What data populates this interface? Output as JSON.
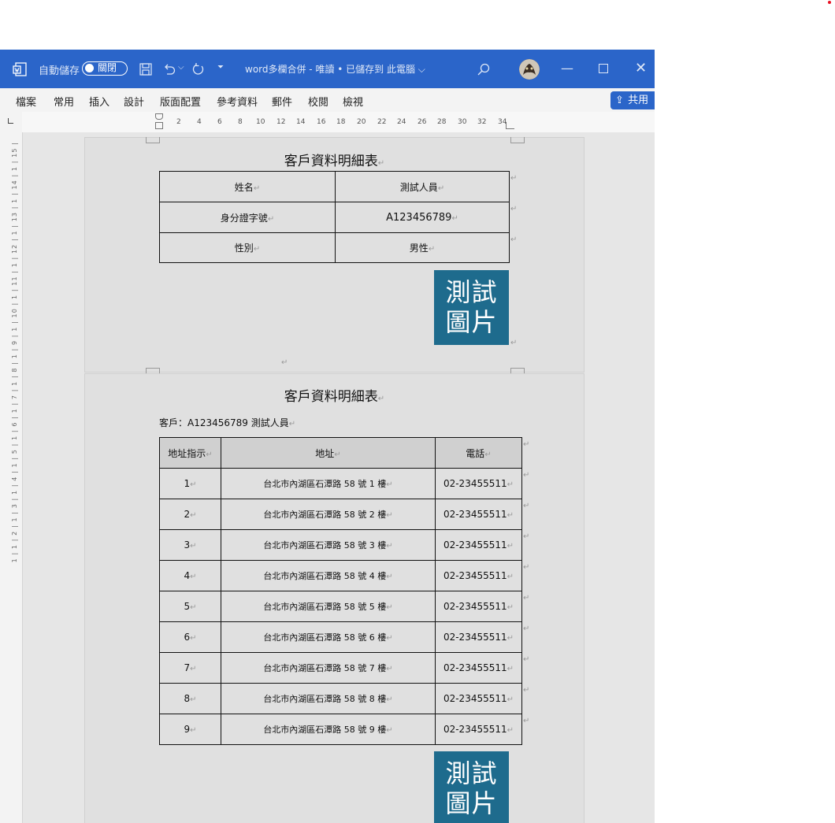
{
  "titlebar": {
    "autosave_label": "自動儲存",
    "autosave_state": "關閉",
    "doc_title": "word多欄合併 - 唯讀 • 已儲存到 此電腦 ⌵"
  },
  "menu": [
    "檔案",
    "常用",
    "插入",
    "設計",
    "版面配置",
    "參考資料",
    "郵件",
    "校閱",
    "檢視"
  ],
  "share_label": "共用 ⌵",
  "ruler": {
    "h": [
      "2",
      "4",
      "6",
      "8",
      "10",
      "12",
      "14",
      "16",
      "18",
      "20",
      "22",
      "24",
      "26",
      "28",
      "30",
      "32",
      "34"
    ],
    "v": "1 | 1 | 2 | 1 | 3 | 1 | 4 | 1 | 5 | 1 | 6 | 1 | 7 | 1 | 8 | 1 | 9 | 1 | 10 | 1 | 11 | 1 | 12 | 1 | 13 | 1 | 14 | 1 | 15 |"
  },
  "page1": {
    "title": "客戶資料明細表",
    "rows": [
      {
        "label": "姓名",
        "value": "測試人員"
      },
      {
        "label": "身分證字號",
        "value": "A123456789"
      },
      {
        "label": "性別",
        "value": "男性"
      }
    ],
    "image_text": [
      "測試",
      "圖片"
    ]
  },
  "page2": {
    "title": "客戶資料明細表",
    "customer_line": "客戶：A123456789 測試人員",
    "headers": [
      "地址指示",
      "地址",
      "電話"
    ],
    "rows": [
      {
        "idx": "1",
        "addr": "台北市內湖區石潭路 58 號 1 樓",
        "phone": "02-23455511"
      },
      {
        "idx": "2",
        "addr": "台北市內湖區石潭路 58 號 2 樓",
        "phone": "02-23455511"
      },
      {
        "idx": "3",
        "addr": "台北市內湖區石潭路 58 號 3 樓",
        "phone": "02-23455511"
      },
      {
        "idx": "4",
        "addr": "台北市內湖區石潭路 58 號 4 樓",
        "phone": "02-23455511"
      },
      {
        "idx": "5",
        "addr": "台北市內湖區石潭路 58 號 5 樓",
        "phone": "02-23455511"
      },
      {
        "idx": "6",
        "addr": "台北市內湖區石潭路 58 號 6 樓",
        "phone": "02-23455511"
      },
      {
        "idx": "7",
        "addr": "台北市內湖區石潭路 58 號 7 樓",
        "phone": "02-23455511"
      },
      {
        "idx": "8",
        "addr": "台北市內湖區石潭路 58 號 8 樓",
        "phone": "02-23455511"
      },
      {
        "idx": "9",
        "addr": "台北市內湖區石潭路 58 號 9 樓",
        "phone": "02-23455511"
      }
    ],
    "image_text": [
      "測試",
      "圖片"
    ]
  },
  "colors": {
    "titlebar": "#2b65c9",
    "image_bg": "#1e6b8d"
  }
}
